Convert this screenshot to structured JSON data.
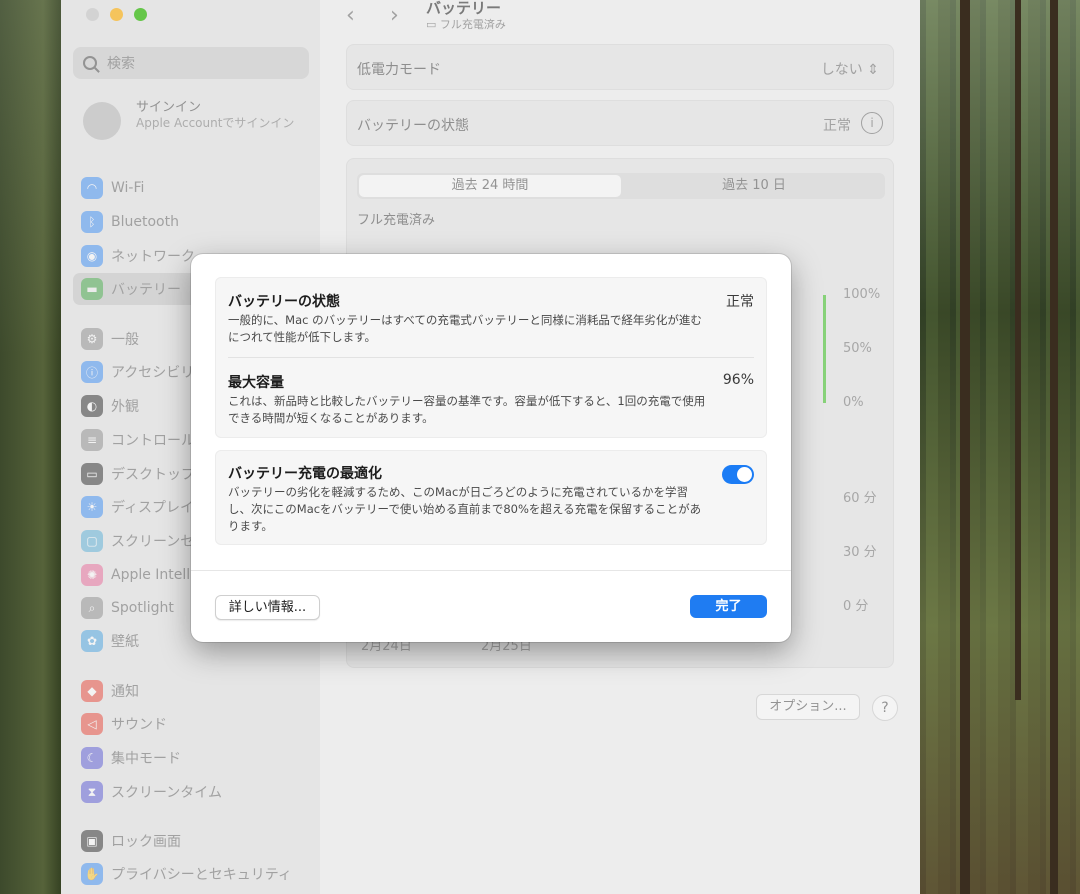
{
  "sidebar": {
    "search_placeholder": "検索",
    "account_title": "サインイン",
    "account_subtitle": "Apple Accountでサインイン",
    "items": [
      {
        "label": "Wi-Fi",
        "icon": "wifi-icon",
        "color": "#3b8cf5"
      },
      {
        "label": "Bluetooth",
        "icon": "bluetooth-icon",
        "color": "#3b8cf5"
      },
      {
        "label": "ネットワーク",
        "icon": "network-icon",
        "color": "#3b8cf5"
      },
      {
        "label": "バッテリー",
        "icon": "battery-icon",
        "color": "#4cb050"
      },
      {
        "label": "一般",
        "icon": "gear-icon",
        "color": "#8e8e8e"
      },
      {
        "label": "アクセシビリティ",
        "icon": "accessibility-icon",
        "color": "#3b8cf5"
      },
      {
        "label": "外観",
        "icon": "appearance-icon",
        "color": "#2a2a2a"
      },
      {
        "label": "コントロールセンター",
        "icon": "control-center-icon",
        "color": "#8e8e8e"
      },
      {
        "label": "デスクトップとDock",
        "icon": "desktop-dock-icon",
        "color": "#2a2a2a"
      },
      {
        "label": "ディスプレイ",
        "icon": "display-icon",
        "color": "#3b8cf5"
      },
      {
        "label": "スクリーンセーバ",
        "icon": "screensaver-icon",
        "color": "#5ab0d8"
      },
      {
        "label": "Apple Intelligence",
        "icon": "apple-intelligence-icon",
        "color": "#e86b9a"
      },
      {
        "label": "Spotlight",
        "icon": "spotlight-icon",
        "color": "#8e8e8e"
      },
      {
        "label": "壁紙",
        "icon": "wallpaper-icon",
        "color": "#4aa3e0"
      },
      {
        "label": "通知",
        "icon": "notifications-icon",
        "color": "#e8483a"
      },
      {
        "label": "サウンド",
        "icon": "sound-icon",
        "color": "#e8483a"
      },
      {
        "label": "集中モード",
        "icon": "focus-icon",
        "color": "#5a5ad6"
      },
      {
        "label": "スクリーンタイム",
        "icon": "screen-time-icon",
        "color": "#5a5ad6"
      },
      {
        "label": "ロック画面",
        "icon": "lock-icon",
        "color": "#2a2a2a"
      },
      {
        "label": "プライバシーとセキュリティ",
        "icon": "privacy-hand-icon",
        "color": "#3b8cf5"
      }
    ]
  },
  "main": {
    "title": "バッテリー",
    "subtitle": "フル充電済み",
    "low_power_label": "低電力モード",
    "low_power_value": "しない",
    "health_label": "バッテリーの状態",
    "health_value": "正常",
    "tabs": [
      "過去 24 時間",
      "過去 10 日"
    ],
    "chart_status": "フル充電済み",
    "battery_axis": [
      "100%",
      "50%",
      "0%"
    ],
    "usage_axis": [
      "60 分",
      "30 分",
      "0 分"
    ],
    "date_labels": [
      "2月24日",
      "2月25日"
    ],
    "options_label": "オプション...",
    "help_label": "?"
  },
  "sheet": {
    "health_title": "バッテリーの状態",
    "health_desc": "一般的に、Mac のバッテリーはすべての充電式バッテリーと同様に消耗品で経年劣化が進むにつれて性能が低下します。",
    "health_value": "正常",
    "capacity_title": "最大容量",
    "capacity_desc": "これは、新品時と比較したバッテリー容量の基準です。容量が低下すると、1回の充電で使用できる時間が短くなることがあります。",
    "capacity_value": "96%",
    "optimize_title": "バッテリー充電の最適化",
    "optimize_desc": "バッテリーの劣化を軽減するため、このMacが日ごろどのように充電されているかを学習し、次にこのMacをバッテリーで使い始める直前まで80%を超える充電を保留することがあります。",
    "optimize_on": true,
    "details_label": "詳しい情報...",
    "done_label": "完了"
  }
}
